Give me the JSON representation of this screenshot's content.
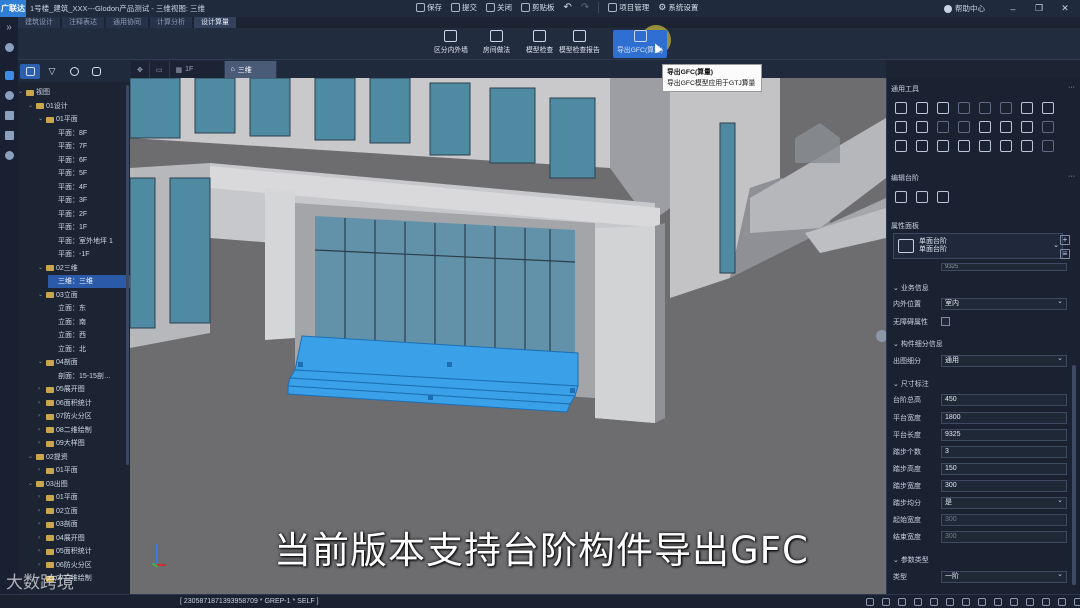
{
  "window": {
    "logo": "广联达",
    "title": "1号楼_建筑_XXX---Glodon产品测试 - 三维视图: 三维"
  },
  "quick_access": [
    {
      "label": "保存",
      "icon": "save-icon"
    },
    {
      "label": "提交",
      "icon": "submit-icon"
    },
    {
      "label": "关闭",
      "icon": "close-doc-icon"
    },
    {
      "label": "剪贴板",
      "icon": "clipboard-icon"
    },
    {
      "label": "项目管理",
      "icon": "project-icon"
    },
    {
      "label": "系统设置",
      "icon": "settings-icon"
    }
  ],
  "help": {
    "label": "帮助中心"
  },
  "ribbon_tabs": [
    "建筑设计",
    "注释表达",
    "通用协同",
    "计算分析",
    "设计算量"
  ],
  "ribbon_buttons": [
    {
      "label": "区分内外墙",
      "icon": "wall-split-icon"
    },
    {
      "label": "房间做法",
      "icon": "room-method-icon"
    },
    {
      "label": "模型检查",
      "icon": "model-check-icon"
    },
    {
      "label": "模型检查报告",
      "icon": "check-report-icon"
    },
    {
      "label": "导出GFC(算量)",
      "icon": "export-gfc-icon"
    }
  ],
  "tooltip": {
    "title": "导出GFC(算量)",
    "desc": "导出GFC模型应用于GTJ算量"
  },
  "view_tabs": [
    {
      "label": "1F",
      "active": false
    },
    {
      "label": "三维",
      "active": true
    }
  ],
  "tree": [
    {
      "label": "视图",
      "level": 0,
      "type": "folder",
      "open": true
    },
    {
      "label": "01设计",
      "level": 1,
      "type": "folder",
      "open": true
    },
    {
      "label": "01平面",
      "level": 2,
      "type": "folder",
      "open": true
    },
    {
      "label": "平面：8F",
      "level": 3
    },
    {
      "label": "平面：7F",
      "level": 3
    },
    {
      "label": "平面：6F",
      "level": 3
    },
    {
      "label": "平面：5F",
      "level": 3
    },
    {
      "label": "平面：4F",
      "level": 3
    },
    {
      "label": "平面：3F",
      "level": 3
    },
    {
      "label": "平面：2F",
      "level": 3
    },
    {
      "label": "平面：1F",
      "level": 3
    },
    {
      "label": "平面：室外地坪 1",
      "level": 3
    },
    {
      "label": "平面：-1F",
      "level": 3
    },
    {
      "label": "02三维",
      "level": 2,
      "type": "folder",
      "open": true
    },
    {
      "label": "三维：三维",
      "level": 3,
      "selected": true
    },
    {
      "label": "03立面",
      "level": 2,
      "type": "folder",
      "open": true
    },
    {
      "label": "立面：东",
      "level": 3
    },
    {
      "label": "立面：南",
      "level": 3
    },
    {
      "label": "立面：西",
      "level": 3
    },
    {
      "label": "立面：北",
      "level": 3
    },
    {
      "label": "04剖面",
      "level": 2,
      "type": "folder",
      "open": true
    },
    {
      "label": "剖面：15-15剖…",
      "level": 3
    },
    {
      "label": "05展开图",
      "level": 2,
      "type": "folder"
    },
    {
      "label": "06面积统计",
      "level": 2,
      "type": "folder"
    },
    {
      "label": "07防火分区",
      "level": 2,
      "type": "folder"
    },
    {
      "label": "08二维绘制",
      "level": 2,
      "type": "folder"
    },
    {
      "label": "09大样图",
      "level": 2,
      "type": "folder"
    },
    {
      "label": "02提资",
      "level": 1,
      "type": "folder",
      "open": true
    },
    {
      "label": "01平面",
      "level": 2,
      "type": "folder"
    },
    {
      "label": "03出图",
      "level": 1,
      "type": "folder",
      "open": true
    },
    {
      "label": "01平面",
      "level": 2,
      "type": "folder"
    },
    {
      "label": "02立面",
      "level": 2,
      "type": "folder"
    },
    {
      "label": "03剖面",
      "level": 2,
      "type": "folder"
    },
    {
      "label": "04展开图",
      "level": 2,
      "type": "folder"
    },
    {
      "label": "05面积统计",
      "level": 2,
      "type": "folder"
    },
    {
      "label": "06防火分区",
      "level": 2,
      "type": "folder"
    },
    {
      "label": "07二维绘制",
      "level": 2,
      "type": "folder"
    }
  ],
  "right_panel": {
    "common_tools": "通用工具",
    "edit_step": "编辑台阶",
    "property_panel": "属性面板",
    "component": {
      "line1": "单面台阶",
      "line2": "单面台阶"
    },
    "cut_value": "9325",
    "groups": {
      "business": "业务信息",
      "detail": "构件细分信息",
      "dimension": "尺寸标注",
      "params": "参数类型"
    },
    "props": {
      "inner_outer": {
        "label": "内外位置",
        "value": "室内"
      },
      "accessible": {
        "label": "无障碍属性"
      },
      "drawing_split": {
        "label": "出图细分",
        "value": "通用"
      },
      "step_total_height": {
        "label": "台阶总高",
        "value": "450"
      },
      "platform_width": {
        "label": "平台宽度",
        "value": "1800"
      },
      "platform_length": {
        "label": "平台长度",
        "value": "9325"
      },
      "step_count": {
        "label": "踏步个数",
        "value": "3"
      },
      "step_height": {
        "label": "踏步高度",
        "value": "150"
      },
      "step_width": {
        "label": "踏步宽度",
        "value": "300"
      },
      "step_equal": {
        "label": "踏步均分",
        "value": "是"
      },
      "start_width": {
        "label": "起始宽度",
        "value": "300"
      },
      "end_width": {
        "label": "结束宽度",
        "value": "300"
      },
      "type": {
        "label": "类型",
        "value": "一阶"
      }
    }
  },
  "subtitle": "当前版本支持台阶构件导出GFC",
  "watermark": "大数跨境",
  "status_bar": {
    "text": "[ 2305871871393958709 * GREP-1 * SELF ]"
  },
  "colors": {
    "accent": "#2e6fd1",
    "selection": "#3aa0e8",
    "highlight": "#ffe63c"
  }
}
